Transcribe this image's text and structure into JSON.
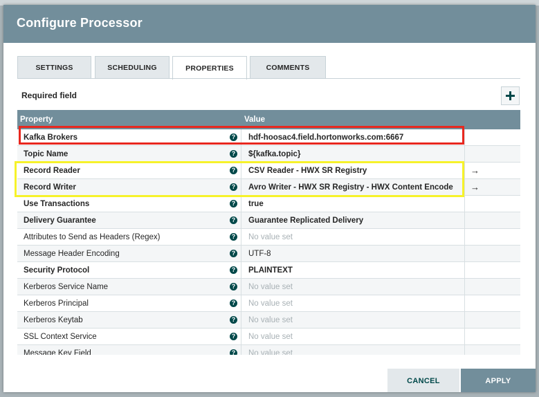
{
  "dialog": {
    "title": "Configure Processor"
  },
  "tabs": [
    {
      "label": "SETTINGS"
    },
    {
      "label": "SCHEDULING"
    },
    {
      "label": "PROPERTIES"
    },
    {
      "label": "COMMENTS"
    }
  ],
  "required_label": "Required field",
  "table": {
    "headers": {
      "property": "Property",
      "value": "Value"
    },
    "rows": [
      {
        "property": "Kafka Brokers",
        "value": "hdf-hoosac4.field.hortonworks.com:6667"
      },
      {
        "property": "Topic Name",
        "value": "${kafka.topic}"
      },
      {
        "property": "Record Reader",
        "value": "CSV Reader - HWX SR Registry",
        "goto": "→"
      },
      {
        "property": "Record Writer",
        "value": "Avro Writer - HWX SR Registry - HWX Content Encode",
        "goto": "→"
      },
      {
        "property": "Use Transactions",
        "value": "true"
      },
      {
        "property": "Delivery Guarantee",
        "value": "Guarantee Replicated Delivery"
      },
      {
        "property": "Attributes to Send as Headers (Regex)",
        "value": "No value set"
      },
      {
        "property": "Message Header Encoding",
        "value": "UTF-8"
      },
      {
        "property": "Security Protocol",
        "value": "PLAINTEXT"
      },
      {
        "property": "Kerberos Service Name",
        "value": "No value set"
      },
      {
        "property": "Kerberos Principal",
        "value": "No value set"
      },
      {
        "property": "Kerberos Keytab",
        "value": "No value set"
      },
      {
        "property": "SSL Context Service",
        "value": "No value set"
      },
      {
        "property": "Message Key Field",
        "value": "No value set"
      }
    ],
    "help_icon": "question-icon"
  },
  "buttons": {
    "cancel": "CANCEL",
    "apply": "APPLY"
  },
  "colors": {
    "header": "#728e9b",
    "accent": "#004849",
    "highlight_red": "#e8281f",
    "highlight_yellow": "#f6f22a"
  }
}
